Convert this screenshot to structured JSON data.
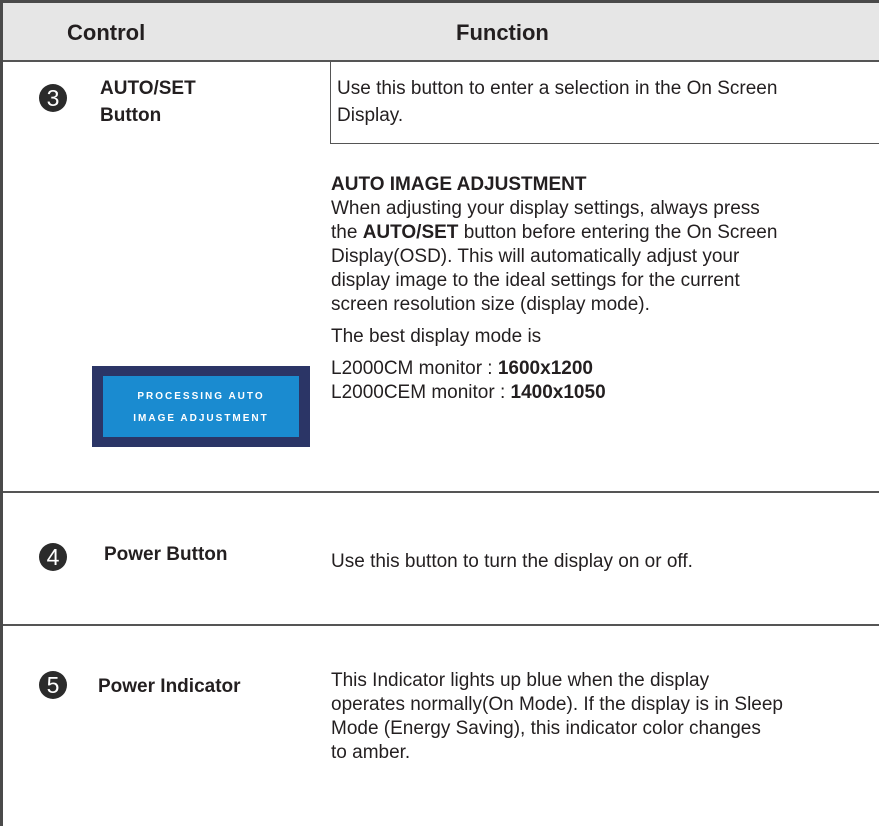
{
  "header": {
    "control": "Control",
    "function": "Function"
  },
  "rows": [
    {
      "number": "3",
      "control_line1": "AUTO/SET",
      "control_line2": "Button",
      "fn_line1": "Use this button to enter a selection in the On Screen",
      "fn_line2": "Display.",
      "auto_heading": "AUTO IMAGE ADJUSTMENT",
      "auto_l1": "When adjusting your display settings, always press",
      "auto_l2_pre": "the ",
      "auto_l2_bold": "AUTO/SET",
      "auto_l2_post": " button before entering the On Screen",
      "auto_l3": "Display(OSD). This will automatically adjust your",
      "auto_l4": "display image to the ideal settings for the current",
      "auto_l5": "screen resolution size (display mode).",
      "best_mode": "The best display mode is",
      "mode1_label": "L2000CM monitor : ",
      "mode1_value": "1600x1200",
      "mode2_label": "L2000CEM monitor : ",
      "mode2_value": "1400x1050",
      "osd_line1": "PROCESSING AUTO",
      "osd_line2": "IMAGE ADJUSTMENT"
    },
    {
      "number": "4",
      "control_line1": "Power Button",
      "fn_line1": "Use this button to turn the display on or off."
    },
    {
      "number": "5",
      "control_line1": "Power Indicator",
      "fn_line1": "This Indicator lights up blue when the display",
      "fn_line2": "operates normally(On Mode). If the display is in Sleep",
      "fn_line3": "Mode (Energy Saving), this indicator color changes",
      "fn_line4": "to amber."
    }
  ]
}
